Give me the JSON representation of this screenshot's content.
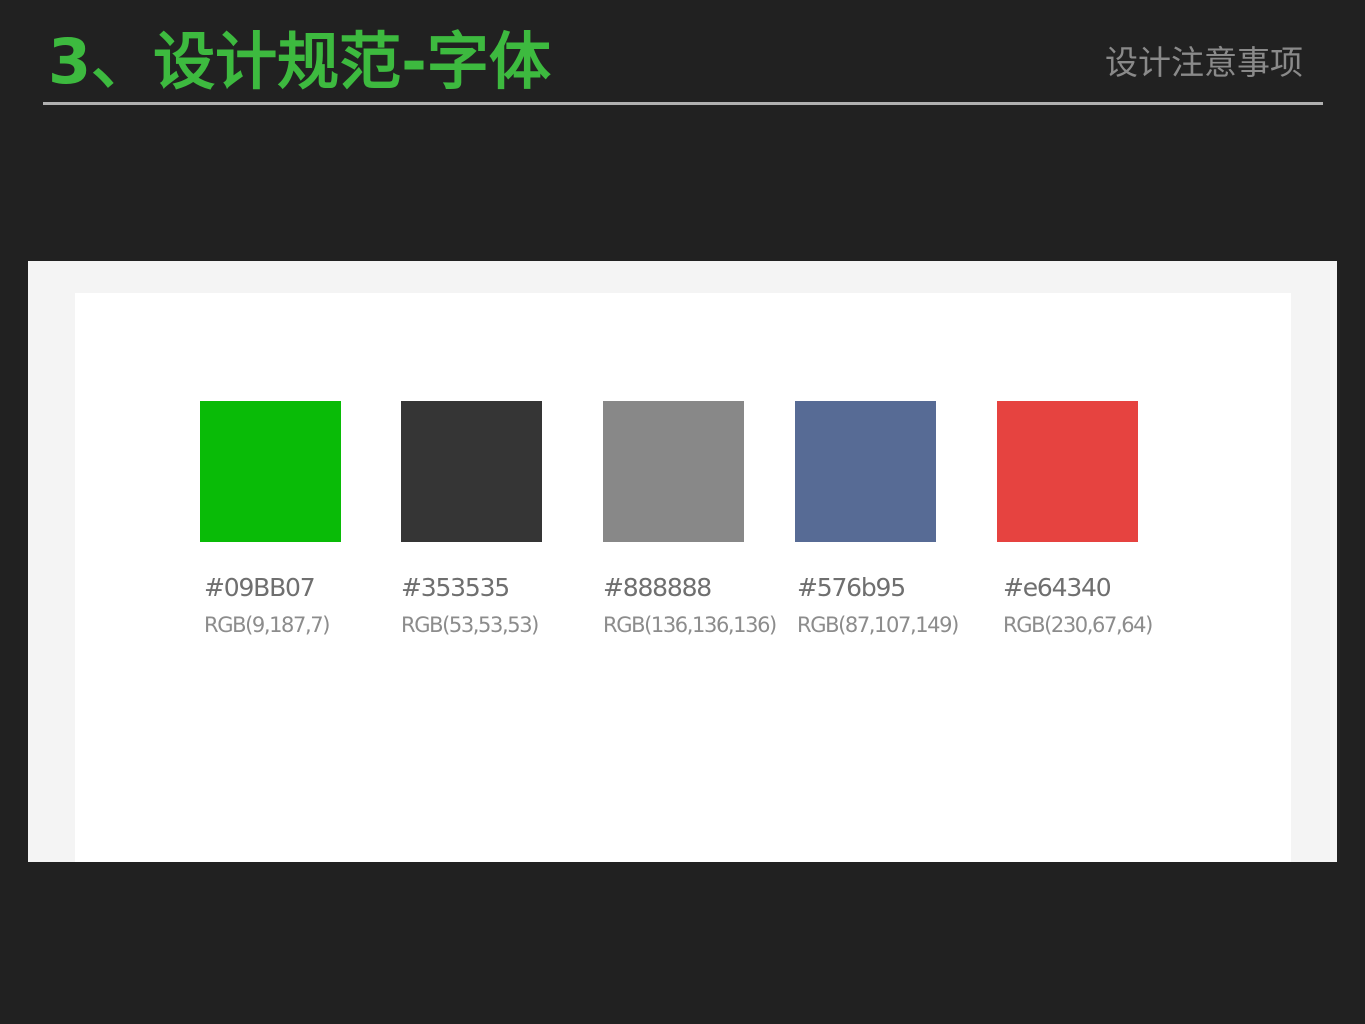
{
  "header": {
    "title": "3、设计规范-字体",
    "subtitle": "设计注意事项"
  },
  "palette": [
    {
      "hex_label": "#09BB07",
      "rgb_label": "RGB(9,187,7)",
      "color": "#09BB07"
    },
    {
      "hex_label": "#353535",
      "rgb_label": "RGB(53,53,53)",
      "color": "#353535"
    },
    {
      "hex_label": "#888888",
      "rgb_label": "RGB(136,136,136)",
      "color": "#888888"
    },
    {
      "hex_label": "#576b95",
      "rgb_label": "RGB(87,107,149)",
      "color": "#576b95"
    },
    {
      "hex_label": "#e64340",
      "rgb_label": "RGB(230,67,64)",
      "color": "#e64340"
    }
  ]
}
